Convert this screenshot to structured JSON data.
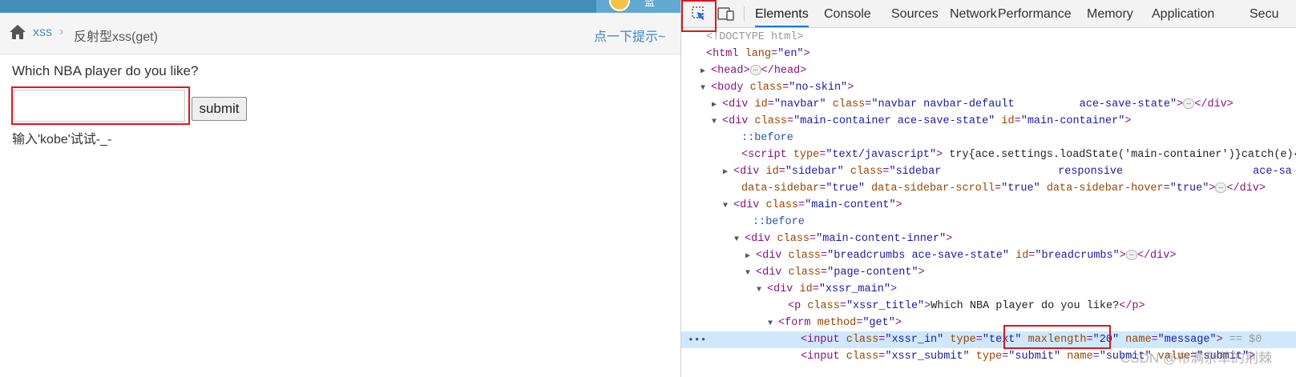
{
  "navbar": {
    "user_label": "蓝"
  },
  "breadcrumb": {
    "item1": "xss",
    "separator": "›",
    "item2": "反射型xss(get)",
    "hint": "点一下提示~"
  },
  "main": {
    "question": "Which NBA player do you like?",
    "input": {
      "value": "",
      "placeholder": ""
    },
    "submit_label": "submit",
    "tip": "输入'kobe'试试-_-"
  },
  "devtools": {
    "tabs": [
      "Elements",
      "Console",
      "Sources",
      "Network",
      "Performance",
      "Memory",
      "Application",
      "Secu"
    ],
    "active_tab": "Elements",
    "dom_lines": [
      {
        "tokens": [
          [
            "cm",
            "<!DOCTYPE html>"
          ]
        ]
      },
      {
        "tokens": [
          [
            "tag",
            "<html "
          ],
          [
            "an",
            "lang"
          ],
          [
            "tag",
            "="
          ],
          [
            "av",
            "\"en\""
          ],
          [
            "tag",
            ">"
          ]
        ]
      },
      {
        "tri": "▶",
        "tokens": [
          [
            "tag",
            "<head>"
          ],
          [
            "ell",
            "…"
          ],
          [
            "tag",
            "</head>"
          ]
        ]
      },
      {
        "tri": "▼",
        "tokens": [
          [
            "tag",
            "<body "
          ],
          [
            "an",
            "class"
          ],
          [
            "tag",
            "="
          ],
          [
            "av",
            "\"no-skin\""
          ],
          [
            "tag",
            ">"
          ]
        ]
      },
      {
        "tri": "▶",
        "tokens": [
          [
            "tag",
            "<div "
          ],
          [
            "an",
            "id"
          ],
          [
            "tag",
            "="
          ],
          [
            "av",
            "\"navbar\""
          ],
          [
            "tag",
            " "
          ],
          [
            "an",
            "class"
          ],
          [
            "tag",
            "="
          ],
          [
            "av",
            "\"navbar navbar-default          ace-save-state\""
          ],
          [
            "tag",
            ">"
          ],
          [
            "ell",
            "…"
          ],
          [
            "tag",
            "</div>"
          ]
        ]
      },
      {
        "tri": "▼",
        "tokens": [
          [
            "tag",
            "<div "
          ],
          [
            "an",
            "class"
          ],
          [
            "tag",
            "="
          ],
          [
            "av",
            "\"main-container ace-save-state\""
          ],
          [
            "tag",
            " "
          ],
          [
            "an",
            "id"
          ],
          [
            "tag",
            "="
          ],
          [
            "av",
            "\"main-container\""
          ],
          [
            "tag",
            ">"
          ]
        ]
      },
      {
        "tokens": [
          [
            "ps",
            "::before"
          ]
        ]
      },
      {
        "tokens": [
          [
            "tag",
            "<script "
          ],
          [
            "an",
            "type"
          ],
          [
            "tag",
            "="
          ],
          [
            "av",
            "\"text/javascript\""
          ],
          [
            "tag",
            ">"
          ],
          [
            "js",
            " try{ace.settings.loadState('main-container')}catch(e){"
          ]
        ]
      },
      {
        "tri": "▶",
        "tokens": [
          [
            "tag",
            "<div "
          ],
          [
            "an",
            "id"
          ],
          [
            "tag",
            "="
          ],
          [
            "av",
            "\"sidebar\""
          ],
          [
            "tag",
            " "
          ],
          [
            "an",
            "class"
          ],
          [
            "tag",
            "="
          ],
          [
            "av",
            "\"sidebar                  responsive                    ace-sa"
          ]
        ]
      },
      {
        "tokens": [
          [
            "an",
            "data-sidebar"
          ],
          [
            "tag",
            "="
          ],
          [
            "av",
            "\"true\""
          ],
          [
            "tag",
            " "
          ],
          [
            "an",
            "data-sidebar-scroll"
          ],
          [
            "tag",
            "="
          ],
          [
            "av",
            "\"true\""
          ],
          [
            "tag",
            " "
          ],
          [
            "an",
            "data-sidebar-hover"
          ],
          [
            "tag",
            "="
          ],
          [
            "av",
            "\"true\""
          ],
          [
            "tag",
            ">"
          ],
          [
            "ell",
            "…"
          ],
          [
            "tag",
            "</div>"
          ]
        ]
      },
      {
        "tri": "▼",
        "tokens": [
          [
            "tag",
            "<div "
          ],
          [
            "an",
            "class"
          ],
          [
            "tag",
            "="
          ],
          [
            "av",
            "\"main-content\""
          ],
          [
            "tag",
            ">"
          ]
        ]
      },
      {
        "tokens": [
          [
            "ps",
            "::before"
          ]
        ]
      },
      {
        "tri": "▼",
        "tokens": [
          [
            "tag",
            "<div "
          ],
          [
            "an",
            "class"
          ],
          [
            "tag",
            "="
          ],
          [
            "av",
            "\"main-content-inner\""
          ],
          [
            "tag",
            ">"
          ]
        ]
      },
      {
        "tri": "▶",
        "tokens": [
          [
            "tag",
            "<div "
          ],
          [
            "an",
            "class"
          ],
          [
            "tag",
            "="
          ],
          [
            "av",
            "\"breadcrumbs ace-save-state\""
          ],
          [
            "tag",
            " "
          ],
          [
            "an",
            "id"
          ],
          [
            "tag",
            "="
          ],
          [
            "av",
            "\"breadcrumbs\""
          ],
          [
            "tag",
            ">"
          ],
          [
            "ell",
            "…"
          ],
          [
            "tag",
            "</div>"
          ]
        ]
      },
      {
        "tri": "▼",
        "tokens": [
          [
            "tag",
            "<div "
          ],
          [
            "an",
            "class"
          ],
          [
            "tag",
            "="
          ],
          [
            "av",
            "\"page-content\""
          ],
          [
            "tag",
            ">"
          ]
        ]
      },
      {
        "tri": "▼",
        "tokens": [
          [
            "tag",
            "<div "
          ],
          [
            "an",
            "id"
          ],
          [
            "tag",
            "="
          ],
          [
            "av",
            "\"xssr_main\""
          ],
          [
            "tag",
            ">"
          ]
        ]
      },
      {
        "tokens": [
          [
            "tag",
            "<p "
          ],
          [
            "an",
            "class"
          ],
          [
            "tag",
            "="
          ],
          [
            "av",
            "\"xssr_title\""
          ],
          [
            "tag",
            ">"
          ],
          [
            "tx",
            "Which NBA player do you like?"
          ],
          [
            "tag",
            "</p>"
          ]
        ]
      },
      {
        "tri": "▼",
        "tokens": [
          [
            "tag",
            "<form "
          ],
          [
            "an",
            "method"
          ],
          [
            "tag",
            "="
          ],
          [
            "av",
            "\"get\""
          ],
          [
            "tag",
            ">"
          ]
        ]
      },
      {
        "sel": true,
        "tokens": [
          [
            "tag",
            "<input "
          ],
          [
            "an",
            "class"
          ],
          [
            "tag",
            "="
          ],
          [
            "av",
            "\"xssr_in\""
          ],
          [
            "tag",
            " "
          ],
          [
            "an",
            "type"
          ],
          [
            "tag",
            "="
          ],
          [
            "av",
            "\"text\""
          ],
          [
            "tag",
            " "
          ],
          [
            "an",
            "maxlength"
          ],
          [
            "tag",
            "="
          ],
          [
            "av",
            "\"20\""
          ],
          [
            "tag",
            " "
          ],
          [
            "an",
            "name"
          ],
          [
            "tag",
            "="
          ],
          [
            "av",
            "\"message\""
          ],
          [
            "tag",
            ">"
          ],
          [
            "cm",
            " == $0"
          ]
        ]
      },
      {
        "tokens": [
          [
            "tag",
            "<input "
          ],
          [
            "an",
            "class"
          ],
          [
            "tag",
            "="
          ],
          [
            "av",
            "\"xssr_submit\""
          ],
          [
            "tag",
            " "
          ],
          [
            "an",
            "type"
          ],
          [
            "tag",
            "="
          ],
          [
            "av",
            "\"submit\""
          ],
          [
            "tag",
            " "
          ],
          [
            "an",
            "name"
          ],
          [
            "tag",
            "="
          ],
          [
            "av",
            "\"submit\""
          ],
          [
            "tag",
            " "
          ],
          [
            "an",
            "value"
          ],
          [
            "tag",
            "="
          ],
          [
            "av",
            "\"submit\""
          ],
          [
            "tag",
            ">"
          ]
        ]
      }
    ],
    "gutter_dots": "•••",
    "watermark": "CSDN @布满杂草的荆棘"
  },
  "colors": {
    "navbar": "#438eb9",
    "link": "#4c8fbd",
    "highlight": "#e0141e",
    "selected_row": "#cfe8fc",
    "tab_active": "#1a73e8"
  }
}
